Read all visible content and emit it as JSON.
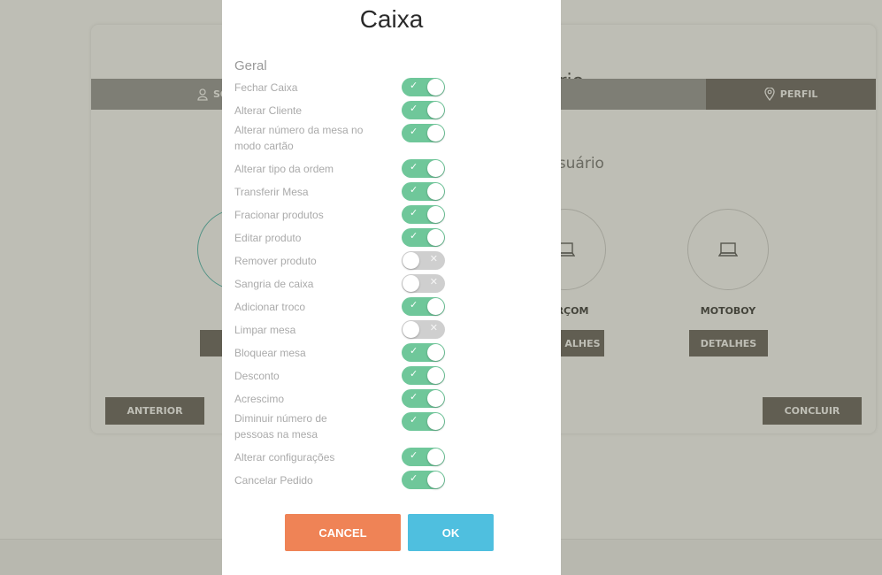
{
  "background": {
    "title_fragment": "ário",
    "subtitle_fragment": "usuário",
    "tabs": [
      {
        "label": "SO",
        "icon": "user-icon"
      },
      {
        "label": "",
        "icon": ""
      },
      {
        "label": "",
        "icon": ""
      },
      {
        "label": "PERFIL",
        "icon": "map-pin-icon"
      }
    ],
    "roles": [
      {
        "label": "",
        "button": "D",
        "icon": "laptop-icon"
      },
      {
        "label": "RÇOM",
        "button": "ALHES",
        "icon": "laptop-icon"
      },
      {
        "label": "MOTOBOY",
        "button": "DETALHES",
        "icon": "laptop-icon"
      }
    ],
    "prev_button": "ANTERIOR",
    "finish_button": "CONCLUIR"
  },
  "modal": {
    "title": "Caixa",
    "section": "Geral",
    "permissions": [
      {
        "label": "Fechar Caixa",
        "enabled": true
      },
      {
        "label": "Alterar Cliente",
        "enabled": true
      },
      {
        "label": "Alterar número da mesa no modo cartão",
        "enabled": true
      },
      {
        "label": "Alterar tipo da ordem",
        "enabled": true
      },
      {
        "label": "Transferir Mesa",
        "enabled": true
      },
      {
        "label": "Fracionar produtos",
        "enabled": true
      },
      {
        "label": "Editar produto",
        "enabled": true
      },
      {
        "label": "Remover produto",
        "enabled": false
      },
      {
        "label": "Sangria de caixa",
        "enabled": false
      },
      {
        "label": "Adicionar troco",
        "enabled": true
      },
      {
        "label": "Limpar mesa",
        "enabled": false
      },
      {
        "label": "Bloquear mesa",
        "enabled": true
      },
      {
        "label": "Desconto",
        "enabled": true
      },
      {
        "label": "Acrescimo",
        "enabled": true
      },
      {
        "label": "Diminuir número de pessoas na mesa",
        "enabled": true
      },
      {
        "label": "Alterar configurações",
        "enabled": true
      },
      {
        "label": "Cancelar Pedido",
        "enabled": true
      }
    ],
    "cancel_label": "CANCEL",
    "ok_label": "OK"
  },
  "colors": {
    "toggle_on": "#6fc79a",
    "toggle_off": "#cfcfcf",
    "cancel": "#ef8356",
    "ok": "#4fbfdf",
    "dark_button": "#57504b"
  }
}
